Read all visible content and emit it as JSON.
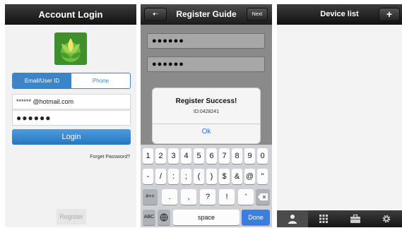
{
  "screen1": {
    "title": "Account Login",
    "tabs": [
      "Email/User ID",
      "Phone"
    ],
    "email_value": "****** @hotmail.com",
    "password_value": "●●●●●●",
    "login_label": "Login",
    "forget_label": "Forget Password?",
    "register_label": "Register"
  },
  "screen2": {
    "title": "Register Guide",
    "back_icon": "left-arrow-icon",
    "next_label": "Next",
    "field1_value": "●●●●●●",
    "field2_value": "●●●●●●",
    "dialog": {
      "title": "Register Success!",
      "message": "ID:0428241",
      "ok_label": "Ok"
    },
    "keyboard": {
      "row1": [
        "1",
        "2",
        "3",
        "4",
        "5",
        "6",
        "7",
        "8",
        "9",
        "0"
      ],
      "row2": [
        "-",
        "/",
        ":",
        ";",
        "(",
        ")",
        "$",
        "&",
        "@",
        "\""
      ],
      "row3_mode": "#+=",
      "row3": [
        ".",
        ",",
        "?",
        "!",
        "'"
      ],
      "abc_label": "ABC",
      "space_label": "space",
      "done_label": "Done"
    }
  },
  "screen3": {
    "title": "Device list",
    "add_label": "+",
    "tabbar_icons": [
      "person-icon",
      "grid-icon",
      "toolbox-icon",
      "gear-icon"
    ]
  },
  "colors": {
    "accent_blue": "#3b84c6",
    "done_blue": "#3a7fe0",
    "header_dark": "#1a1a1a"
  }
}
